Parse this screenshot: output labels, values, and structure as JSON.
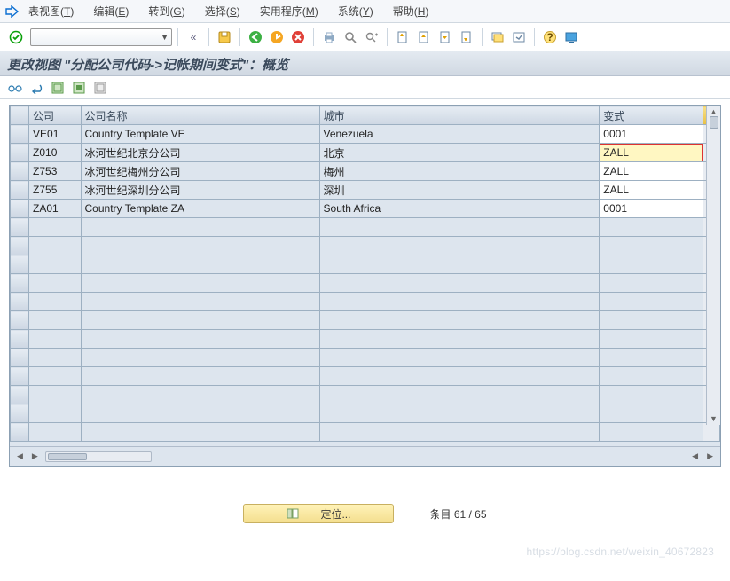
{
  "menu": {
    "items": [
      {
        "label": "表视图(",
        "key": "T",
        "suffix": ")"
      },
      {
        "label": "编辑(",
        "key": "E",
        "suffix": ")"
      },
      {
        "label": "转到(",
        "key": "G",
        "suffix": ")"
      },
      {
        "label": "选择(",
        "key": "S",
        "suffix": ")"
      },
      {
        "label": "实用程序(",
        "key": "M",
        "suffix": ")"
      },
      {
        "label": "系统(",
        "key": "Y",
        "suffix": ")"
      },
      {
        "label": "帮助(",
        "key": "H",
        "suffix": ")"
      }
    ]
  },
  "title": "更改视图 \"分配公司代码->记帐期间变式\"：概览",
  "toolbar_icons": {
    "back": "«",
    "save": "save",
    "g_back": "green-back",
    "g_exit": "orange-exit",
    "g_cancel": "red-cancel",
    "print": "print",
    "find": "find",
    "findnext": "find-next",
    "first": "page-first",
    "prev": "page-prev",
    "next": "page-next",
    "last": "page-last",
    "new": "create-session",
    "shortcut": "gen-shortcut",
    "help": "help",
    "layout": "gui-options"
  },
  "tb2": [
    "glasses-icon",
    "undo-icon",
    "select-all-icon",
    "select-block-icon",
    "deselect-icon"
  ],
  "table": {
    "headers": [
      "公司",
      "公司名称",
      "城市",
      "变式"
    ],
    "rows": [
      {
        "code": "VE01",
        "name": "Country Template VE",
        "city": "Venezuela",
        "variant": "0001",
        "hl": false
      },
      {
        "code": "Z010",
        "name": "冰河世纪北京分公司",
        "city": "北京",
        "variant": "ZALL",
        "hl": true
      },
      {
        "code": "Z753",
        "name": "冰河世纪梅州分公司",
        "city": "梅州",
        "variant": "ZALL",
        "hl": false
      },
      {
        "code": "Z755",
        "name": "冰河世纪深圳分公司",
        "city": "深圳",
        "variant": "ZALL",
        "hl": false
      },
      {
        "code": "ZA01",
        "name": "Country Template ZA",
        "city": "South Africa",
        "variant": "0001",
        "hl": false
      }
    ],
    "empty_rows": 12
  },
  "footer": {
    "position_label": "定位...",
    "entry_label": "条目",
    "entry_value": "61 / 65"
  },
  "watermark": "https://blog.csdn.net/weixin_40672823"
}
